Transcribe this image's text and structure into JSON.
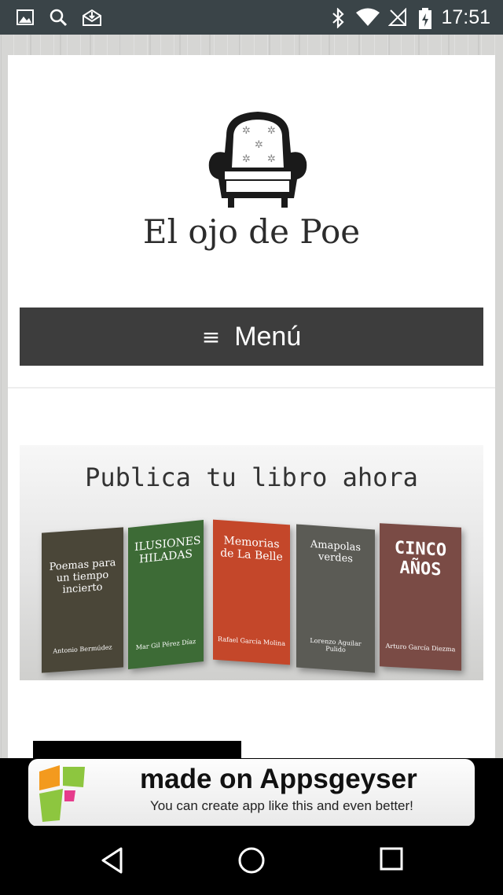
{
  "status_bar": {
    "time": "17:51",
    "left_icons": [
      "image-icon",
      "search-icon",
      "mail-download-icon"
    ],
    "right_icons": [
      "bluetooth-icon",
      "wifi-icon",
      "no-signal-icon",
      "battery-charging-icon"
    ]
  },
  "site": {
    "title": "El ojo de Poe",
    "logo": "armchair-logo"
  },
  "menu": {
    "icon": "hamburger-icon",
    "icon_glyph": "≡",
    "label": "Menú"
  },
  "banner": {
    "title": "Publica tu libro ahora",
    "books": [
      {
        "title": "Poemas para un tiempo incierto",
        "author": "Antonio Bermúdez",
        "color": "#4a4638"
      },
      {
        "title": "ILUSIONES HILADAS",
        "author": "Mar Gil Pérez Díaz",
        "color": "#3d6b36"
      },
      {
        "title": "Memorias de La Belle",
        "author": "Rafael García Molina",
        "color": "#c4472a"
      },
      {
        "title": "Amapolas verdes",
        "author": "Lorenzo Aguilar Pulido",
        "color": "#5b5b55"
      },
      {
        "title": "CINCO AÑOS",
        "author": "Arturo García Diezma",
        "color": "#7a4b45"
      }
    ]
  },
  "ad": {
    "title": "made on Appsgeyser",
    "subtitle": "You can create app like this and even better!"
  },
  "nav": {
    "back": "back-icon",
    "home": "home-icon",
    "recents": "recents-icon"
  }
}
